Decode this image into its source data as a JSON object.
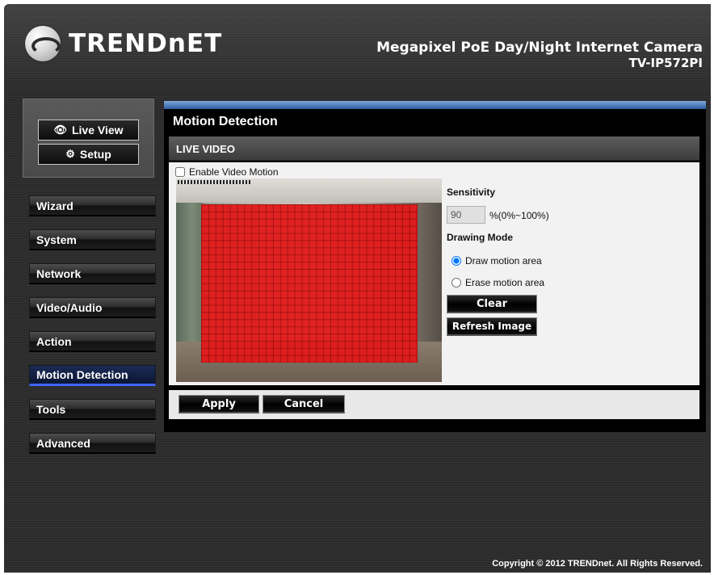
{
  "brand": {
    "logo_text": "TRENDnET"
  },
  "header": {
    "product_name": "Megapixel PoE Day/Night Internet Camera",
    "model": "TV-IP572PI"
  },
  "view_buttons": {
    "live_view": "Live View",
    "setup": "Setup"
  },
  "nav": {
    "items": [
      {
        "label": "Wizard",
        "active": false
      },
      {
        "label": "System",
        "active": false
      },
      {
        "label": "Network",
        "active": false
      },
      {
        "label": "Video/Audio",
        "active": false
      },
      {
        "label": "Action",
        "active": false
      },
      {
        "label": "Motion Detection",
        "active": true
      },
      {
        "label": "Tools",
        "active": false
      },
      {
        "label": "Advanced",
        "active": false
      }
    ]
  },
  "main": {
    "title": "Motion Detection",
    "section_title": "LIVE VIDEO",
    "enable_label": "Enable Video Motion",
    "enable_checked": false,
    "sensitivity_label": "Sensitivity",
    "sensitivity_value": "90",
    "sensitivity_range": "%(0%~100%)",
    "drawing_mode_label": "Drawing Mode",
    "radio_draw": "Draw motion area",
    "radio_erase": "Erase motion area",
    "selected_mode": "draw",
    "clear_button": "Clear",
    "refresh_button": "Refresh Image"
  },
  "actions": {
    "apply": "Apply",
    "cancel": "Cancel"
  },
  "footer": {
    "copyright": "Copyright © 2012 TRENDnet. All Rights Reserved."
  },
  "colors": {
    "motion_area": "#e31a1a",
    "active_nav_underline": "#3d66ff",
    "top_bar": "#2e5da3"
  }
}
